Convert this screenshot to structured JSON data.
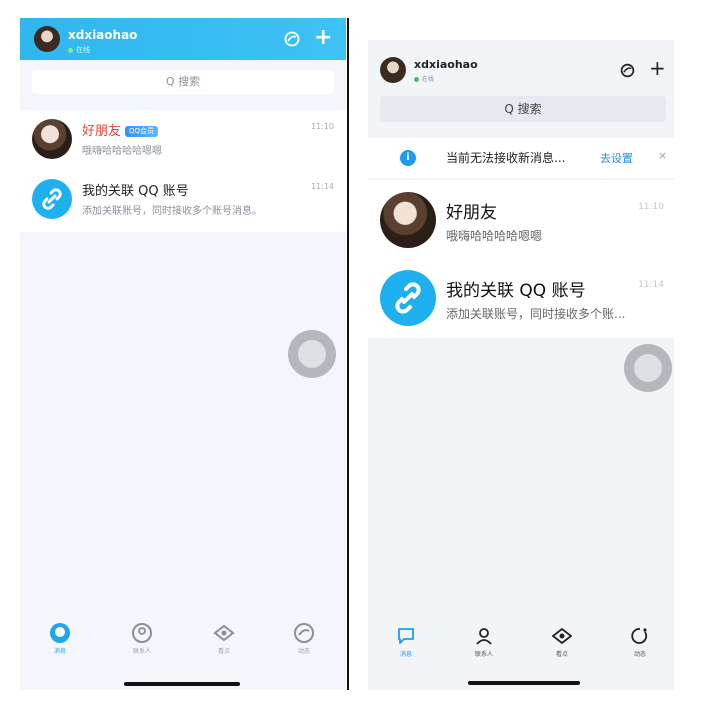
{
  "colors": {
    "accent": "#2fb7ee",
    "link_avatar": "#1fb0ef",
    "badge": "#3a8ff5"
  },
  "left_phone": {
    "header": {
      "username": "xdxiaohao",
      "status": "在线",
      "globe_icon": "globe-icon",
      "plus_label": "+"
    },
    "search": {
      "label": "Q 搜索"
    },
    "conversations": [
      {
        "name": "好朋友",
        "badge": "QQ会员",
        "message": "哦嗨哈哈哈哈嗯嗯",
        "time": "11:10"
      },
      {
        "name": "我的关联 QQ 账号",
        "message": "添加关联账号，同时接收多个账号消息。",
        "time": "11:14"
      }
    ],
    "tabbar": [
      {
        "label": "消息",
        "icon": "chat-icon",
        "active": true
      },
      {
        "label": "联系人",
        "icon": "contacts-icon",
        "active": false
      },
      {
        "label": "看点",
        "icon": "eye-icon",
        "active": false
      },
      {
        "label": "动态",
        "icon": "star-icon",
        "active": false
      }
    ]
  },
  "right_phone": {
    "header": {
      "username": "xdxiaohao",
      "status": "在线",
      "globe_icon": "globe-icon",
      "plus_label": "+"
    },
    "search": {
      "label": "Q 搜索"
    },
    "notice": {
      "info_symbol": "i",
      "text": "当前无法接收新消息...",
      "link": "去设置",
      "close": "×"
    },
    "conversations": [
      {
        "name": "好朋友",
        "message": "哦嗨哈哈哈哈嗯嗯",
        "time": "11:10"
      },
      {
        "name": "我的关联 QQ 账号",
        "message": "添加关联账号，同时接收多个账...",
        "time": "11:14"
      }
    ],
    "tabbar": [
      {
        "label": "消息",
        "icon": "chat-icon",
        "active": true
      },
      {
        "label": "联系人",
        "icon": "contacts-icon",
        "active": false
      },
      {
        "label": "看点",
        "icon": "eye-icon",
        "active": false
      },
      {
        "label": "动态",
        "icon": "refresh-icon",
        "active": false
      }
    ]
  }
}
